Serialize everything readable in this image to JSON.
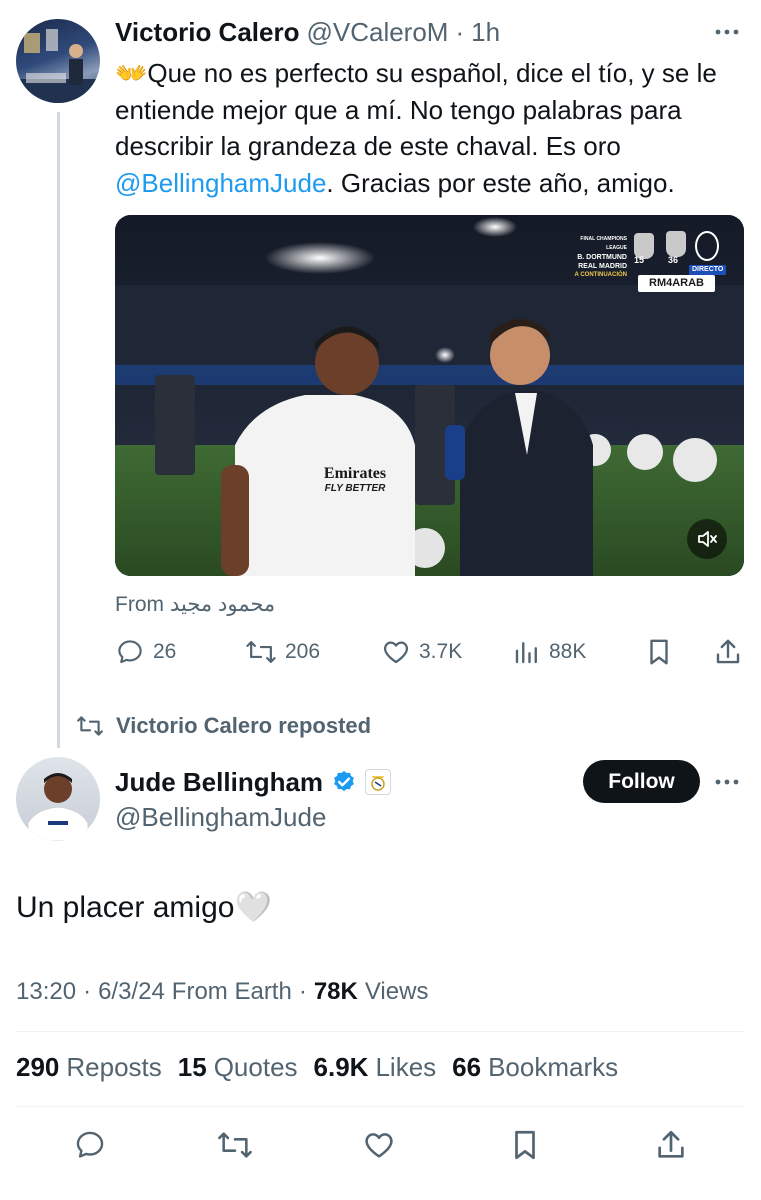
{
  "tweet1": {
    "author_name": "Victorio Calero",
    "author_handle": "@VCaleroM",
    "separator": "·",
    "time": "1h",
    "emoji": "👐",
    "text_main": "Que no es perfecto su español, dice el tío, y se le entiende mejor que a mí. No tengo palabras para describir la grandeza de este chaval. Es oro ",
    "mention": "@BellinghamJude",
    "text_end": ". Gracias por este año, amigo.",
    "video": {
      "scoreboard_line1": "FINAL CHAMPIONS LEAGUE",
      "scoreboard_line2": "B. DORTMUND",
      "scoreboard_line3": "REAL MADRID",
      "scoreboard_line4": "A CONTINUACIÓN",
      "trophy_count_1": "15",
      "trophy_count_2": "36",
      "live_label": "DIRECTO",
      "watermark": "RM4ARAB",
      "shirt_sponsor": "Emirates",
      "shirt_slogan": "FLY BETTER"
    },
    "from_label": "From",
    "from_name": "محمود مجيد",
    "replies": "26",
    "reposts": "206",
    "likes": "3.7K",
    "views": "88K"
  },
  "repost_banner": "Victorio Calero reposted",
  "tweet2": {
    "author_name": "Jude Bellingham",
    "author_handle": "@BellinghamJude",
    "follow_label": "Follow",
    "text": "Un placer amigo",
    "emoji": "🤍",
    "meta_time": "13:20",
    "meta_sep1": "·",
    "meta_date": "6/3/24",
    "meta_from": "From Earth",
    "meta_sep2": "·",
    "meta_views_num": "78K",
    "meta_views_lbl": "Views",
    "stats": [
      {
        "num": "290",
        "label": "Reposts"
      },
      {
        "num": "15",
        "label": "Quotes"
      },
      {
        "num": "6.9K",
        "label": "Likes"
      },
      {
        "num": "66",
        "label": "Bookmarks"
      }
    ]
  },
  "colors": {
    "accent": "#1d9bf0",
    "text": "#0f1419",
    "muted": "#536471",
    "verified": "#1d9bf0"
  }
}
